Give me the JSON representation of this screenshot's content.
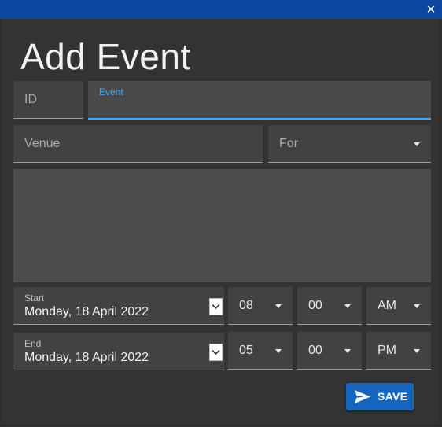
{
  "window": {
    "close_glyph": "✕"
  },
  "form": {
    "title": "Add Event",
    "id_field": {
      "placeholder": "ID",
      "value": ""
    },
    "event_field": {
      "label": "Event",
      "value": ""
    },
    "venue_field": {
      "placeholder": "Venue",
      "value": ""
    },
    "for_select": {
      "placeholder": "For"
    },
    "description": {
      "value": ""
    },
    "start": {
      "label": "Start",
      "date": "Monday, 18 April 2022",
      "hour": "08",
      "minute": "00",
      "ampm": "AM"
    },
    "end": {
      "label": "End",
      "date": "Monday, 18 April 2022",
      "hour": "05",
      "minute": "00",
      "ampm": "PM"
    },
    "save_label": "SAVE"
  },
  "colors": {
    "titlebar": "#0d47a1",
    "accent": "#42a5f5",
    "save_button": "#1565c0",
    "background": "#303030",
    "field": "#424242"
  },
  "icons": {
    "close": "close-icon",
    "caret": "caret-down-icon",
    "calendar": "chevron-down-icon",
    "save": "send-icon"
  }
}
